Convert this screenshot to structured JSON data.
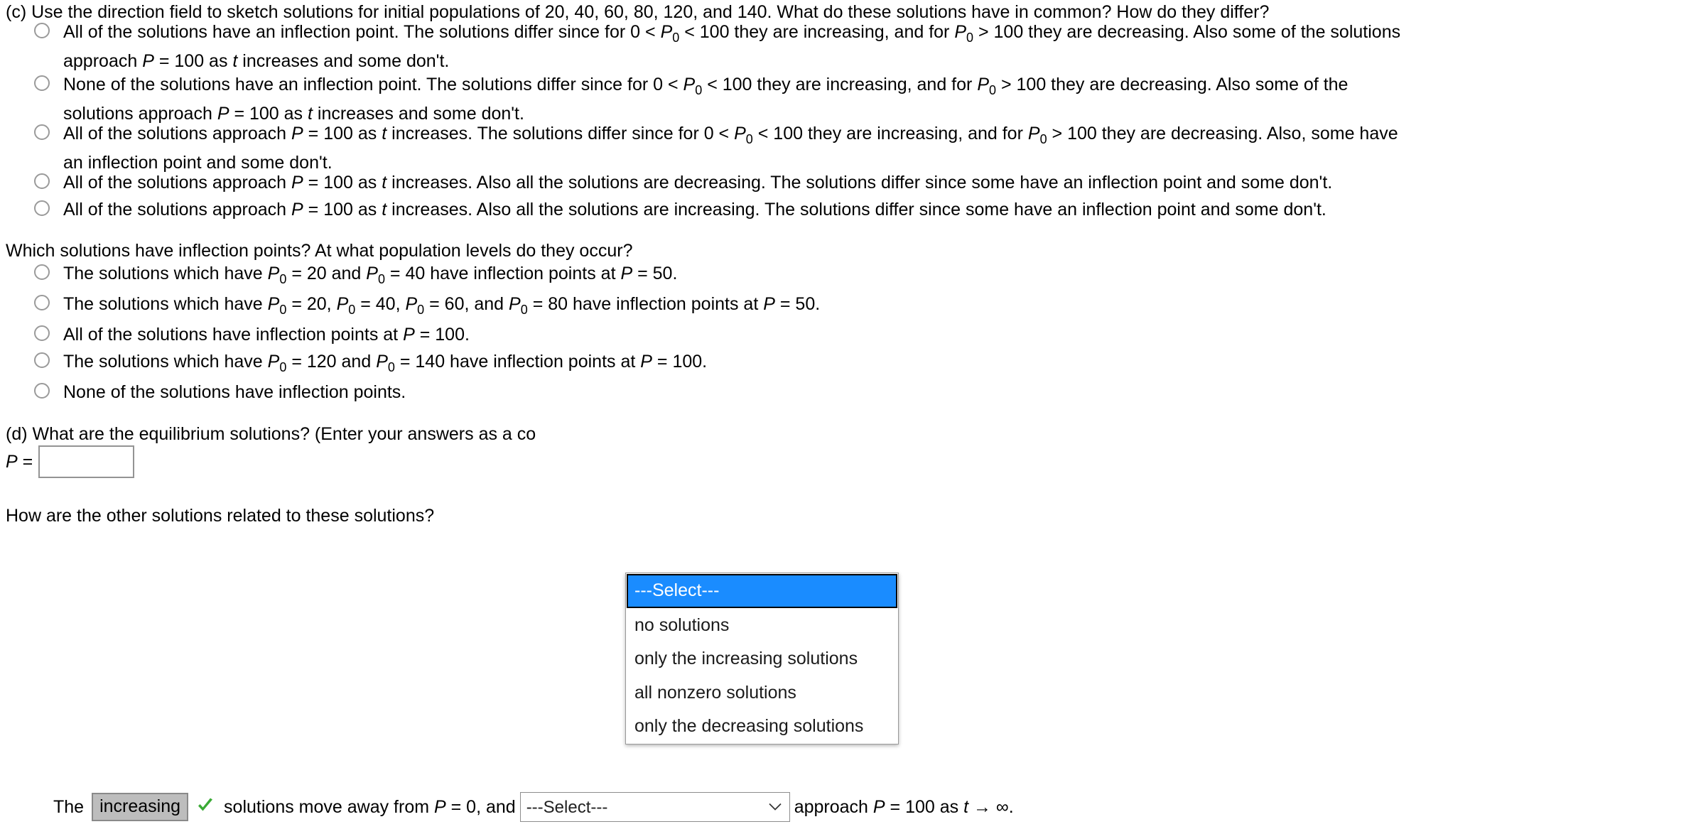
{
  "part_c": {
    "prompt": "(c) Use the direction field to sketch solutions for initial populations of 20, 40, 60, 80, 120, and 140. What do these solutions have in common? How do they differ?",
    "options": [
      {
        "line1_a": "All of the solutions have an inflection point. The solutions differ since for 0 < ",
        "p0_1": "P",
        "sub_1": "0",
        "line1_b": " < 100 they are increasing, and for ",
        "p0_2": "P",
        "sub_2": "0",
        "line1_c": " > 100 they are decreasing. Also some of the solutions",
        "line2_a": "approach ",
        "p_italic": "P",
        "line2_b": " = 100 as ",
        "t_italic": "t",
        "line2_c": " increases and some don't."
      },
      {
        "line1_a": "None of the solutions have an inflection point. The solutions differ since for 0 < ",
        "p0_1": "P",
        "sub_1": "0",
        "line1_b": " < 100 they are increasing, and for ",
        "p0_2": "P",
        "sub_2": "0",
        "line1_c": " > 100 they are decreasing. Also some of the",
        "line2_a": "solutions approach ",
        "p_italic": "P",
        "line2_b": " = 100 as ",
        "t_italic": "t",
        "line2_c": " increases and some don't."
      },
      {
        "line1_a": "All of the solutions approach ",
        "p_italic": "P",
        "line1_a2": " = 100 as ",
        "t_italic": "t",
        "line1_a3": " increases. The solutions differ since for 0 < ",
        "p0_1": "P",
        "sub_1": "0",
        "line1_b": " < 100 they are increasing, and for ",
        "p0_2": "P",
        "sub_2": "0",
        "line1_c": " > 100 they are decreasing. Also, some have",
        "line2_a": "an inflection point and some don't."
      },
      {
        "a": "All of the solutions approach ",
        "p_italic": "P",
        "b": " = 100 as ",
        "t_italic": "t",
        "c": " increases. Also all the solutions are decreasing. The solutions differ since some have an inflection point and some don't."
      },
      {
        "a": "All of the solutions approach ",
        "p_italic": "P",
        "b": " = 100 as ",
        "t_italic": "t",
        "c": " increases. Also all the solutions are increasing. The solutions differ since some have an inflection point and some don't."
      }
    ]
  },
  "inflection_question": {
    "prompt": "Which solutions have inflection points? At what population levels do they occur?",
    "options": [
      {
        "a": "The solutions which have ",
        "p0_1": "P",
        "sub_1": "0",
        "b": " = 20 and ",
        "p0_2": "P",
        "sub_2": "0",
        "c": " = 40 have inflection points at ",
        "p_italic": "P",
        "d": " = 50."
      },
      {
        "a": "The solutions which have ",
        "p0_1": "P",
        "sub_1": "0",
        "b": " = 20, ",
        "p0_2": "P",
        "sub_2": "0",
        "c": " = 40, ",
        "p0_3": "P",
        "sub_3": "0",
        "d": " = 60, and ",
        "p0_4": "P",
        "sub_4": "0",
        "e": " = 80 have inflection points at ",
        "p_italic": "P",
        "f": " = 50."
      },
      {
        "a": "All of the solutions have inflection points at ",
        "p_italic": "P",
        "b": " = 100."
      },
      {
        "a": "The solutions which have ",
        "p0_1": "P",
        "sub_1": "0",
        "b": " = 120 and ",
        "p0_2": "P",
        "sub_2": "0",
        "c": " = 140 have inflection points at ",
        "p_italic": "P",
        "d": " = 100."
      },
      {
        "a": "None of the solutions have inflection points."
      }
    ]
  },
  "part_d": {
    "prompt": "(d) What are the equilibrium solutions? (Enter your answers as a co",
    "p_label_italic": "P",
    "p_label_eq": " =",
    "answer_value": "",
    "answer_placeholder": ""
  },
  "bottom": {
    "prompt": "How are the other solutions related to these solutions?",
    "the_word": "The",
    "graded_answer": "increasing",
    "check_icon": "green-check-icon",
    "mid_text_a": "solutions move away from ",
    "p_italic": "P",
    "mid_text_b": " = 0, and",
    "select_value": "---Select---",
    "tail_a": "approach ",
    "p_italic_2": "P",
    "tail_b": " = 100 as ",
    "t_italic": "t",
    "tail_c": " → ∞."
  },
  "dropdown": {
    "aria_label": "solutions-relation-select",
    "items": [
      "---Select---",
      "no solutions",
      "only the increasing solutions",
      "all nonzero solutions",
      "only the decreasing solutions"
    ],
    "selected_index": 0,
    "highlight_color": "#1a8cff"
  },
  "colors": {
    "highlight": "#1a8cff",
    "check_green": "#3aaa35",
    "answer_box_fill": "#bdbdbd",
    "radio_border": "#9a9a9a"
  }
}
